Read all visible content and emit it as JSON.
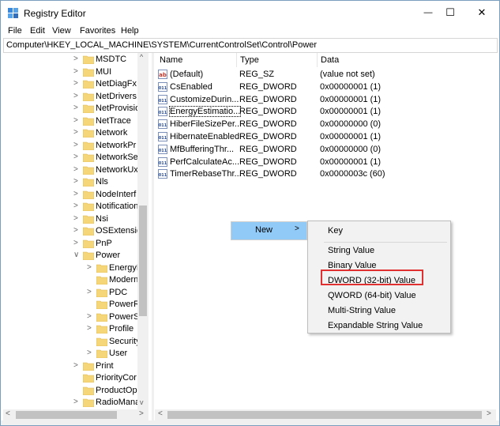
{
  "window": {
    "title": "Registry Editor",
    "minimize_glyph": "—",
    "maximize_glyph": "☐",
    "close_glyph": "✕"
  },
  "menubar": [
    "File",
    "Edit",
    "View",
    "Favorites",
    "Help"
  ],
  "address": "Computer\\HKEY_LOCAL_MACHINE\\SYSTEM\\CurrentControlSet\\Control\\Power",
  "tree": {
    "expand_glyph": ">",
    "collapse_glyph": "∨",
    "items": [
      {
        "label": "MSDTC",
        "level": 0,
        "state": "collapsed"
      },
      {
        "label": "MUI",
        "level": 0,
        "state": "collapsed"
      },
      {
        "label": "NetDiagFx",
        "level": 0,
        "state": "collapsed"
      },
      {
        "label": "NetDrivers",
        "level": 0,
        "state": "collapsed"
      },
      {
        "label": "NetProvisio",
        "level": 0,
        "state": "collapsed"
      },
      {
        "label": "NetTrace",
        "level": 0,
        "state": "collapsed"
      },
      {
        "label": "Network",
        "level": 0,
        "state": "collapsed"
      },
      {
        "label": "NetworkPr",
        "level": 0,
        "state": "collapsed"
      },
      {
        "label": "NetworkSe",
        "level": 0,
        "state": "collapsed"
      },
      {
        "label": "NetworkUx",
        "level": 0,
        "state": "collapsed"
      },
      {
        "label": "Nls",
        "level": 0,
        "state": "collapsed"
      },
      {
        "label": "NodeInterf",
        "level": 0,
        "state": "collapsed"
      },
      {
        "label": "Notification",
        "level": 0,
        "state": "collapsed"
      },
      {
        "label": "Nsi",
        "level": 0,
        "state": "collapsed"
      },
      {
        "label": "OSExtensio",
        "level": 0,
        "state": "collapsed"
      },
      {
        "label": "PnP",
        "level": 0,
        "state": "collapsed"
      },
      {
        "label": "Power",
        "level": 0,
        "state": "expanded"
      },
      {
        "label": "EnergyE",
        "level": 1,
        "state": "collapsed"
      },
      {
        "label": "Modern",
        "level": 1,
        "state": "none"
      },
      {
        "label": "PDC",
        "level": 1,
        "state": "collapsed"
      },
      {
        "label": "PowerR",
        "level": 1,
        "state": "none"
      },
      {
        "label": "PowerS",
        "level": 1,
        "state": "collapsed"
      },
      {
        "label": "Profile",
        "level": 1,
        "state": "collapsed"
      },
      {
        "label": "Security",
        "level": 1,
        "state": "none"
      },
      {
        "label": "User",
        "level": 1,
        "state": "collapsed"
      },
      {
        "label": "Print",
        "level": 0,
        "state": "collapsed"
      },
      {
        "label": "PriorityCor",
        "level": 0,
        "state": "none"
      },
      {
        "label": "ProductOp",
        "level": 0,
        "state": "none"
      },
      {
        "label": "RadioMana",
        "level": 0,
        "state": "collapsed"
      }
    ]
  },
  "list": {
    "columns": [
      "Name",
      "Type",
      "Data"
    ],
    "rows": [
      {
        "icon": "string-value-icon",
        "name": "(Default)",
        "type": "REG_SZ",
        "data": "(value not set)"
      },
      {
        "icon": "binary-value-icon",
        "name": "CsEnabled",
        "type": "REG_DWORD",
        "data": "0x00000001 (1)"
      },
      {
        "icon": "binary-value-icon",
        "name": "CustomizeDurin...",
        "type": "REG_DWORD",
        "data": "0x00000001 (1)"
      },
      {
        "icon": "binary-value-icon",
        "name": "EnergyEstimatio...",
        "type": "REG_DWORD",
        "data": "0x00000001 (1)"
      },
      {
        "icon": "binary-value-icon",
        "name": "HiberFileSizePer...",
        "type": "REG_DWORD",
        "data": "0x00000000 (0)"
      },
      {
        "icon": "binary-value-icon",
        "name": "HibernateEnabled",
        "type": "REG_DWORD",
        "data": "0x00000001 (1)"
      },
      {
        "icon": "binary-value-icon",
        "name": "MfBufferingThr...",
        "type": "REG_DWORD",
        "data": "0x00000000 (0)"
      },
      {
        "icon": "binary-value-icon",
        "name": "PerfCalculateAc...",
        "type": "REG_DWORD",
        "data": "0x00000001 (1)"
      },
      {
        "icon": "binary-value-icon",
        "name": "TimerRebaseThr...",
        "type": "REG_DWORD",
        "data": "0x0000003c (60)"
      }
    ]
  },
  "context_menu": {
    "new_label": "New",
    "new_arrow": ">",
    "submenu": [
      "Key",
      "String Value",
      "Binary Value",
      "DWORD (32-bit) Value",
      "QWORD (64-bit) Value",
      "Multi-String Value",
      "Expandable String Value"
    ],
    "highlighted_item": "DWORD (32-bit) Value",
    "highlight_color": "#e03030"
  },
  "colors": {
    "folder": "#f5d77a",
    "menu_hover": "#91c9f7",
    "scrollbar_thumb": "#c2c2c2"
  },
  "scroll": {
    "left_arrow": "<",
    "right_arrow": ">",
    "up_arrow": "^",
    "down_arrow": "v"
  }
}
